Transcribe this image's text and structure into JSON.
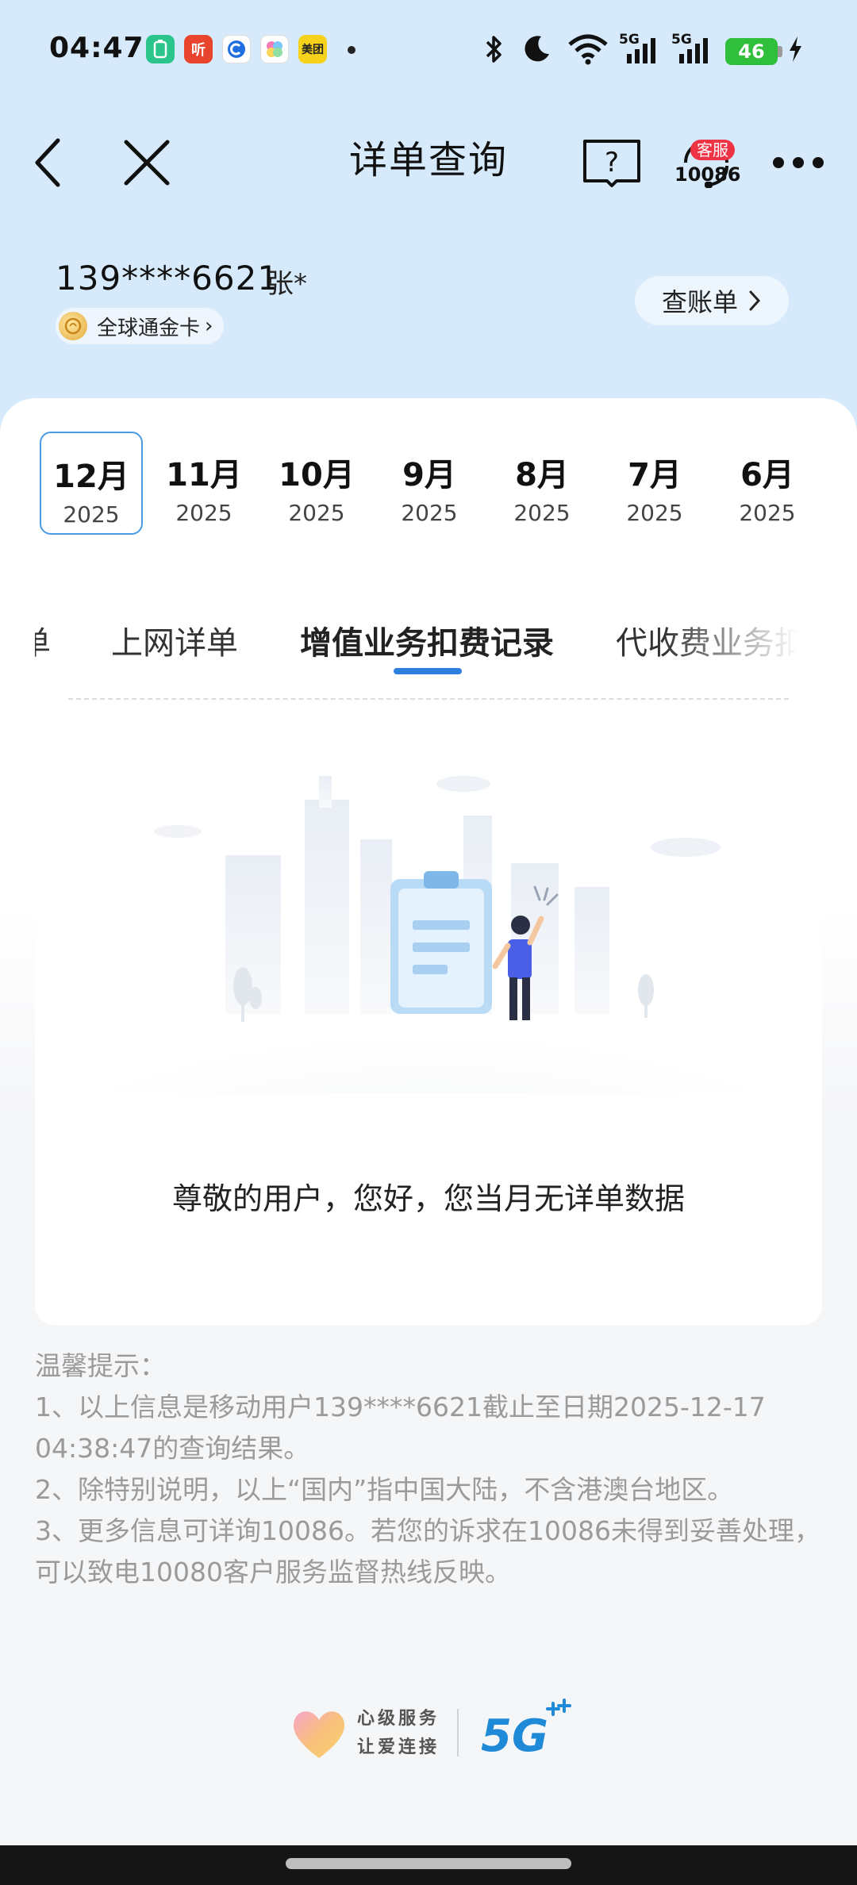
{
  "status_bar": {
    "time": "04:47",
    "apps": [
      {
        "icon": "battery-app-icon",
        "label": "",
        "color": "#2bc48a"
      },
      {
        "icon": "ting-app-icon",
        "label": "听",
        "color": "#e8442e"
      },
      {
        "icon": "c-app-icon",
        "label": "",
        "color": "#1f6fe0"
      },
      {
        "icon": "flower-app-icon",
        "label": "",
        "color": "#f0f0f0"
      },
      {
        "icon": "meituan-app-icon",
        "label": "美团",
        "color": "#f7d21a"
      }
    ],
    "network_left": "5G",
    "network_right": "5G",
    "battery": "46"
  },
  "nav": {
    "title": "详单查询",
    "service_badge": "客服",
    "service_number": "10086"
  },
  "account": {
    "phone": "139****6621",
    "name": "张*",
    "plan": "全球通金卡",
    "plan_chevron": "›",
    "bill_button": "查账单"
  },
  "months": [
    {
      "month": "12月",
      "year": "2025",
      "selected": true
    },
    {
      "month": "11月",
      "year": "2025",
      "selected": false
    },
    {
      "month": "10月",
      "year": "2025",
      "selected": false
    },
    {
      "month": "9月",
      "year": "2025",
      "selected": false
    },
    {
      "month": "8月",
      "year": "2025",
      "selected": false
    },
    {
      "month": "7月",
      "year": "2025",
      "selected": false
    },
    {
      "month": "6月",
      "year": "2025",
      "selected": false
    }
  ],
  "tabs": [
    {
      "label": "单",
      "active": false
    },
    {
      "label": "上网详单",
      "active": false
    },
    {
      "label": "增值业务扣费记录",
      "active": true
    },
    {
      "label": "代收费业务扣费",
      "active": false
    }
  ],
  "empty_message": "尊敬的用户，您好，您当月无详单数据",
  "tips": {
    "title": "温馨提示：",
    "line1": "1、以上信息是移动用户139****6621截止至日期2025-12-17 04:38:47的查询结果。",
    "line2": "2、除特别说明，以上“国内”指中国大陆，不含港澳台地区。",
    "line3": "3、更多信息可详询10086。若您的诉求在10086未得到妥善处理，可以致电10080客户服务监督热线反映。"
  },
  "footer": {
    "slogan1": "心级服务",
    "slogan2": "让爱连接",
    "brand": "5G"
  },
  "colors": {
    "accent": "#2f7fe0",
    "header_bg": "#d6eafb",
    "battery": "#2fbf3a"
  }
}
